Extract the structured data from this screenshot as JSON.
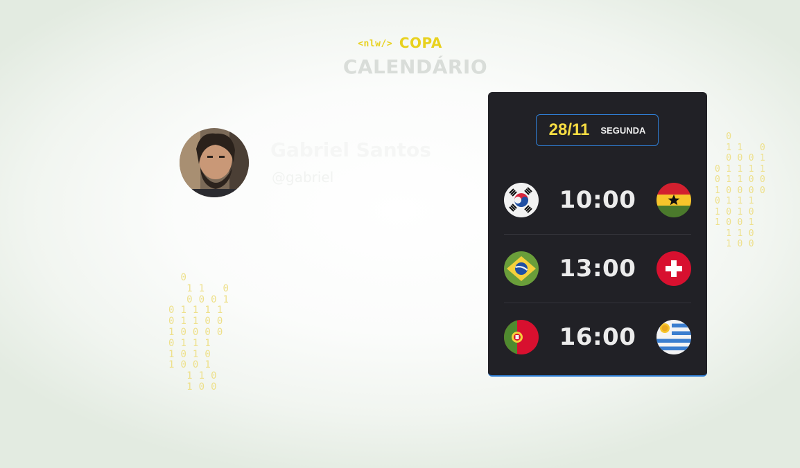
{
  "header": {
    "logo_nlw": "<nlw/>",
    "logo_copa": "COPA",
    "title": "CALENDÁRIO"
  },
  "profile": {
    "name": "Gabriel Santos",
    "handle": "@gabriel"
  },
  "decor": {
    "binary_left": "  0\n   1 1   0\n   0 0 0 1\n0 1 1 1 1\n0 1 1 0 0\n1 0 0 0 0\n0 1 1 1\n1 0 1 0\n1 0 0 1\n   1 1 0\n   1 0 0",
    "binary_right": "  0\n  1 1   0\n  0 0 0 1\n0 1 1 1 1\n0 1 1 0 0\n1 0 0 0 0\n0 1 1 1\n1 0 1 0\n1 0 0 1\n  1 1 0\n  1 0 0"
  },
  "card": {
    "date": "28/11",
    "weekday": "SEGUNDA",
    "games": [
      {
        "time": "10:00",
        "home_flag": "south-korea-flag-icon",
        "away_flag": "ghana-flag-icon"
      },
      {
        "time": "13:00",
        "home_flag": "brazil-flag-icon",
        "away_flag": "switzerland-flag-icon"
      },
      {
        "time": "16:00",
        "home_flag": "portugal-flag-icon",
        "away_flag": "uruguay-flag-icon"
      }
    ]
  },
  "colors": {
    "accent_yellow": "#f7dd43",
    "accent_blue": "#2f7fd6",
    "card_bg": "#212126"
  }
}
